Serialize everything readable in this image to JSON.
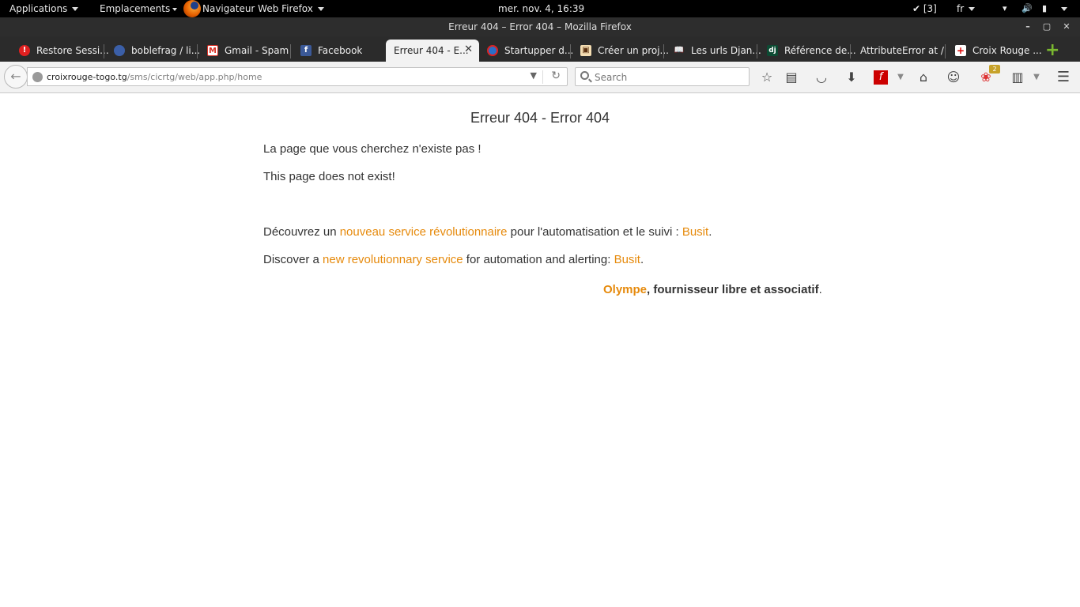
{
  "topbar": {
    "applications": "Applications",
    "places": "Emplacements",
    "active_app": "Navigateur Web Firefox",
    "clock": "mer. nov.  4, 16:39",
    "updates": "✔ [3]",
    "lang": "fr"
  },
  "window": {
    "title": "Erreur 404 – Error 404 – Mozilla Firefox"
  },
  "tabs": [
    {
      "label": "Restore Sessi...",
      "icon": "restore-icon",
      "color": "#e02020"
    },
    {
      "label": "boblefrag / li...",
      "icon": "github-icon",
      "color": "#3b5fa8"
    },
    {
      "label": "Gmail - Spam",
      "icon": "gmail-icon",
      "color": "#d93025"
    },
    {
      "label": "Facebook",
      "icon": "facebook-icon",
      "color": "#3b5998"
    },
    {
      "label": "Erreur 404 - E...",
      "icon": "",
      "color": ""
    },
    {
      "label": "Startupper d...",
      "icon": "globe-icon",
      "color": "#2a6fc9"
    },
    {
      "label": "Créer un proj...",
      "icon": "page-icon",
      "color": "#c05a20"
    },
    {
      "label": "Les urls Djan...",
      "icon": "book-icon",
      "color": "#ffffff"
    },
    {
      "label": "Référence de...",
      "icon": "django-icon",
      "color": "#0c4b33"
    },
    {
      "label": "AttributeError at /",
      "icon": "",
      "color": ""
    },
    {
      "label": "Croix Rouge ...",
      "icon": "redcross-icon",
      "color": "#ffffff"
    }
  ],
  "navbar": {
    "url_host": "croixrouge-togo.tg",
    "url_path": "/sms/cicrtg/web/app.php/home",
    "search_placeholder": "Search",
    "badge_count": "2"
  },
  "page": {
    "heading": "Erreur 404 - Error 404",
    "msg_fr": "La page que vous cherchez n'existe pas !",
    "msg_en": "This page does not exist!",
    "discover_fr_pre": "Découvrez un ",
    "discover_fr_link": "nouveau service révolutionnaire",
    "discover_fr_mid": " pour l'automatisation et le suivi : ",
    "discover_fr_link2": "Busit",
    "discover_fr_end": ".",
    "discover_en_pre": "Discover a ",
    "discover_en_link": "new revolutionnary service",
    "discover_en_mid": " for automation and alerting: ",
    "discover_en_link2": "Busit",
    "discover_en_end": ".",
    "sign_link": "Olympe",
    "sign_text": ", fournisseur libre et associatif",
    "sign_end": "."
  },
  "colors": {
    "link": "#e68a0c",
    "text": "#333333"
  }
}
